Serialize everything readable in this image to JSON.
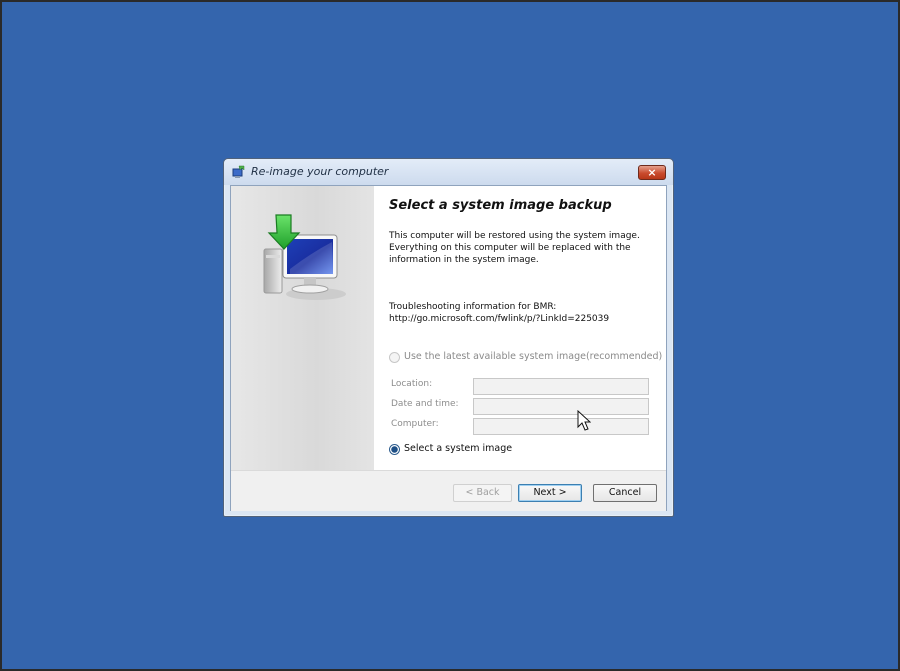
{
  "window": {
    "title": "Re-image your computer",
    "close_glyph": "×"
  },
  "content": {
    "heading": "Select a system image backup",
    "description_lines": [
      "This computer will be restored using the system image.",
      "Everything on this computer will be replaced with the",
      "information in the system image."
    ],
    "troubleshooting_lines": [
      "Troubleshooting information for BMR:",
      "http://go.microsoft.com/fwlink/p/?LinkId=225039"
    ]
  },
  "options": {
    "latest_image_label": "Use the latest available system image(recommended)",
    "select_image_label": "Select a system image",
    "selected": "select_image"
  },
  "fields": {
    "location_label": "Location:",
    "location_value": "",
    "date_time_label": "Date and time:",
    "date_time_value": "",
    "computer_label": "Computer:",
    "computer_value": ""
  },
  "buttons": {
    "back": "< Back",
    "next": "Next >",
    "cancel": "Cancel"
  },
  "colors": {
    "desktop_background": "#3465ad",
    "close_button": "#c94b2e",
    "selected_radio": "#1d4f86"
  },
  "icons": {
    "title": "system-restore-icon",
    "hero": "computer-restore-icon",
    "cursor": "mouse-pointer-icon"
  }
}
